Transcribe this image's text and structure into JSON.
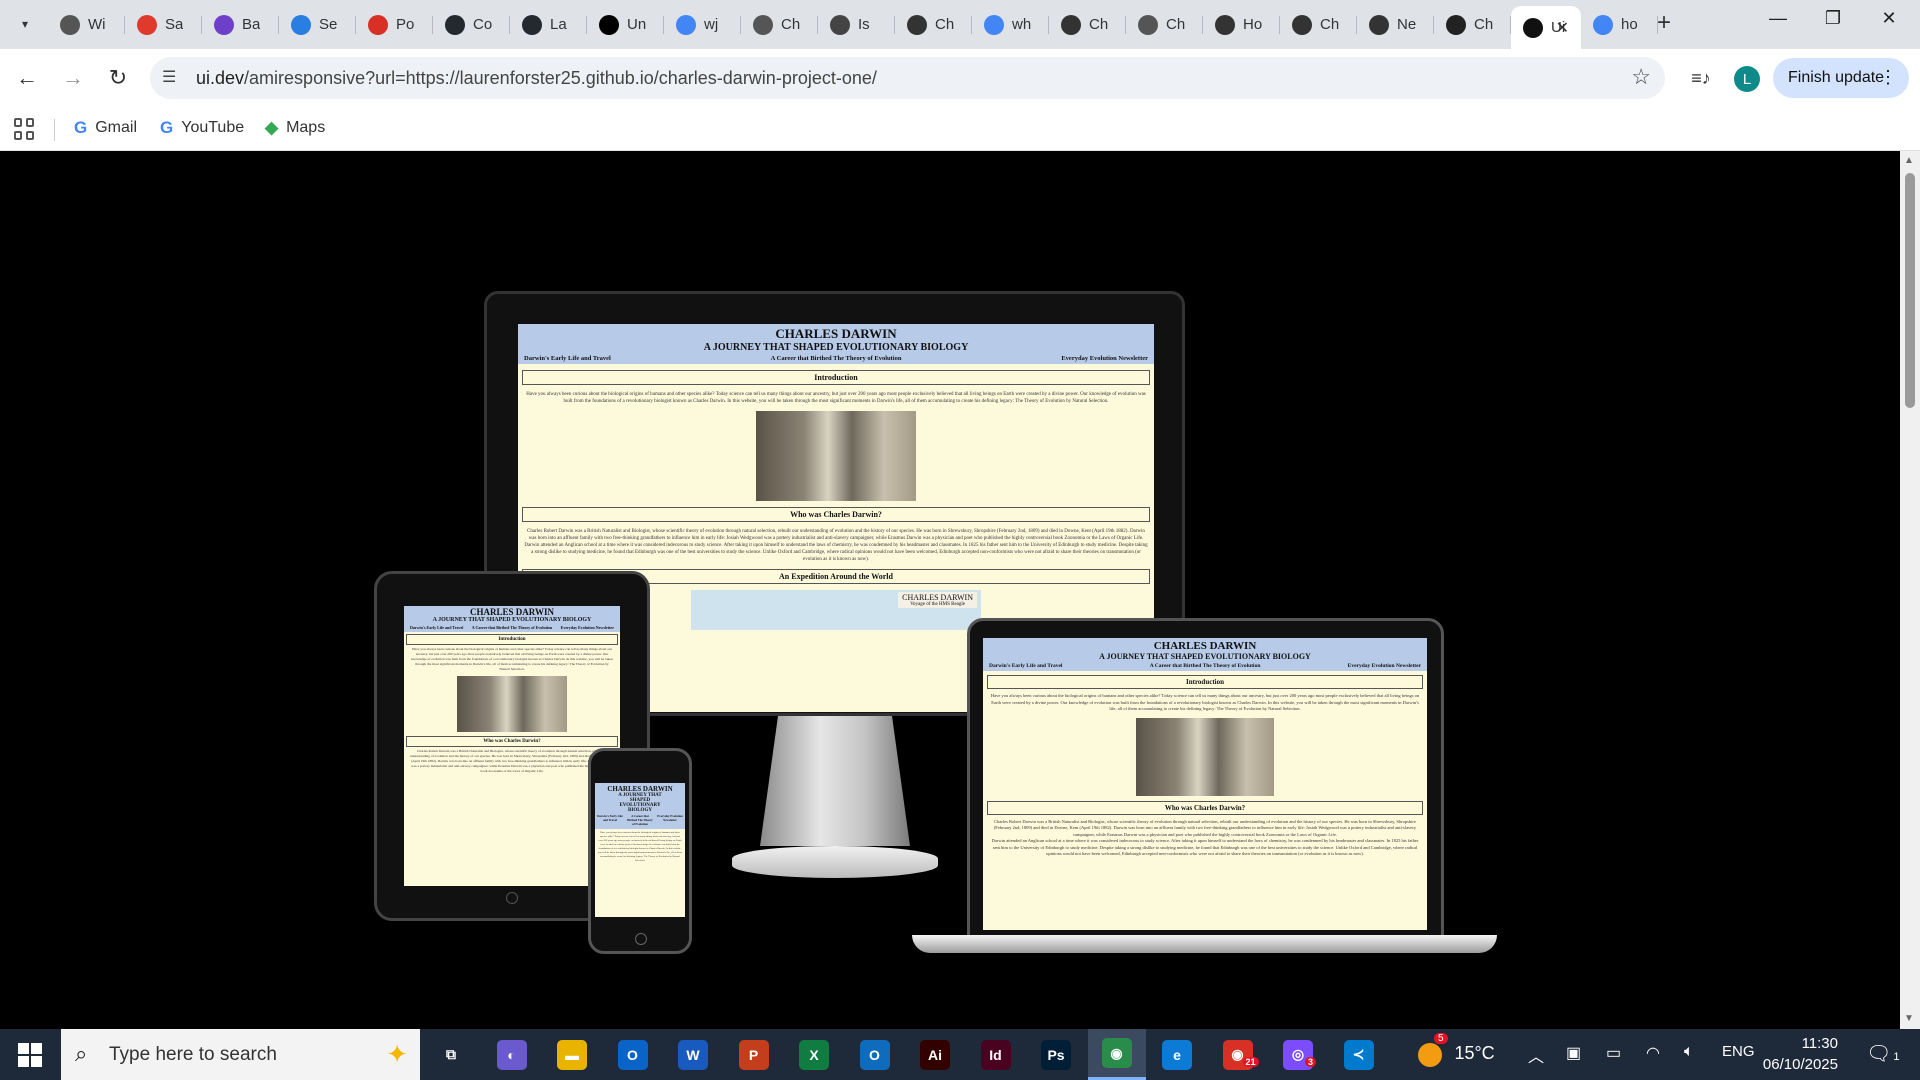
{
  "browser": {
    "tabs": [
      {
        "label": "Wi",
        "icon": "wikipedia-icon",
        "color": "#555555"
      },
      {
        "label": "Sa",
        "icon": "opera-icon",
        "color": "#e03a2c"
      },
      {
        "label": "Ba",
        "icon": "github-icon",
        "color": "#6e40c9"
      },
      {
        "label": "Se",
        "icon": "puzzle-icon",
        "color": "#2a7de1"
      },
      {
        "label": "Po",
        "icon": "gmail-icon",
        "color": "#d93025"
      },
      {
        "label": "Co",
        "icon": "github-icon",
        "color": "#24292f"
      },
      {
        "label": "La",
        "icon": "github-icon",
        "color": "#24292f"
      },
      {
        "label": "Un",
        "icon": "medium-icon",
        "color": "#000000"
      },
      {
        "label": "wj",
        "icon": "google-icon",
        "color": "#4285f4"
      },
      {
        "label": "Ch",
        "icon": "globe-icon",
        "color": "#555555"
      },
      {
        "label": "Is",
        "icon": "stack-icon",
        "color": "#444444"
      },
      {
        "label": "Ch",
        "icon": "openai-icon",
        "color": "#333333"
      },
      {
        "label": "wh",
        "icon": "google-icon",
        "color": "#4285f4"
      },
      {
        "label": "Ch",
        "icon": "openai-icon",
        "color": "#333333"
      },
      {
        "label": "Ch",
        "icon": "globe-icon",
        "color": "#555555"
      },
      {
        "label": "Ho",
        "icon": "feather-icon",
        "color": "#333333"
      },
      {
        "label": "Ch",
        "icon": "openai-icon",
        "color": "#333333"
      },
      {
        "label": "Ne",
        "icon": "openai-icon",
        "color": "#333333"
      },
      {
        "label": "Ch",
        "icon": "pen-icon",
        "color": "#222222"
      }
    ],
    "active_tab": {
      "label": "Ui",
      "icon": "ui-dev-icon"
    },
    "last_tab": {
      "label": "ho",
      "icon": "google-icon"
    },
    "url_host": "ui.dev",
    "url_rest": "/amiresponsive?url=https://laurenforster25.github.io/charles-darwin-project-one/",
    "profile_initial": "L",
    "finish_update": "Finish update",
    "bookmarks": [
      {
        "label": "Gmail"
      },
      {
        "label": "YouTube"
      },
      {
        "label": "Maps"
      }
    ]
  },
  "site": {
    "title": "CHARLES DARWIN",
    "subtitle": "A JOURNEY THAT SHAPED EVOLUTIONARY BIOLOGY",
    "subtitle_phone_1": "A JOURNEY THAT",
    "subtitle_phone_2": "SHAPED",
    "subtitle_phone_3": "EVOLUTIONARY",
    "subtitle_phone_4": "BIOLOGY",
    "nav": [
      "Darwin's Early Life and Travel",
      "A Career that Birthed The Theory of Evolution",
      "Everyday Evolution Newsletter"
    ],
    "intro_heading": "Introduction",
    "intro_text": "Have you always been curious about the biological origins of humans and other species alike? Today science can tell us many things about our ancestry, but just over 200 years ago most people exclusively believed that all living beings on Earth were created by a divine power. Our knowledge of evolution was built from the foundations of a revolutionary biologist known as Charles Darwin. In this website, you will be taken through the most significant moments in Darwin's life, all of them accumulating to create his defining legacy: The Theory of Evolution by Natural Selection.",
    "who_heading": "Who was Charles Darwin?",
    "who_text": "Charles Robert Darwin was a British Naturalist and Biologist, whose scientific theory of evolution through natural selection, rebuilt our understanding of evolution and the history of our species. He was born in Shrewsbury, Shropshire (February 2nd, 1809) and died in Downe, Kent (April 19th 1882). Darwin was born into an affluent family with two free-thinking grandfathers to influence him in early life: Josiah Wedgwood was a pottery industrialist and anti-slavery campaigner, while Erasmus Darwin was a physician and poet who published the highly controversial book Zoonomia or the Laws of Organic Life.",
    "who_text_2": "Darwin attended an Anglican school at a time where it was considered indecorous to study science. After taking it upon himself to understand the laws of chemistry, he was condemned by his headmaster and classmates. In 1825 his father sent him to the University of Edinburgh to study medicine. Despite taking a strong dislike to studying medicine, he found that Edinburgh was one of the best universities to study the science. Unlike Oxford and Cambridge, where radical opinions would not have been welcomed, Edinburgh accepted non-conformists who were not afraid to share their theories on transmutation (or evolution as it is known as now).",
    "expedition_heading": "An Expedition Around the World",
    "map_caption": "CHARLES DARWIN",
    "map_sub": "Voyage of the HMS Beagle"
  },
  "taskbar": {
    "search_placeholder": "Type here to search",
    "apps": [
      {
        "name": "task-view",
        "glyph": "⧉",
        "color": "#1e2a3a"
      },
      {
        "name": "copilot",
        "glyph": "◐",
        "color": "#6a5acd"
      },
      {
        "name": "file-explorer",
        "glyph": "▬",
        "color": "#e8b400"
      },
      {
        "name": "outlook",
        "glyph": "O",
        "color": "#0a64c8"
      },
      {
        "name": "word",
        "glyph": "W",
        "color": "#185abd"
      },
      {
        "name": "powerpoint",
        "glyph": "P",
        "color": "#c43e1c"
      },
      {
        "name": "excel",
        "glyph": "X",
        "color": "#107c41"
      },
      {
        "name": "outlook-classic",
        "glyph": "O",
        "color": "#0f6cbd"
      },
      {
        "name": "illustrator",
        "glyph": "Ai",
        "color": "#330000"
      },
      {
        "name": "indesign",
        "glyph": "Id",
        "color": "#49021f"
      },
      {
        "name": "photoshop",
        "glyph": "Ps",
        "color": "#001e36"
      },
      {
        "name": "chrome",
        "glyph": "◉",
        "color": "#2a8c4a"
      },
      {
        "name": "edge",
        "glyph": "e",
        "color": "#0c7bd6"
      },
      {
        "name": "chrome-profile",
        "glyph": "◉",
        "color": "#d93025"
      },
      {
        "name": "messenger",
        "glyph": "◎",
        "color": "#7b4dff"
      },
      {
        "name": "vscode",
        "glyph": "≺",
        "color": "#007acc"
      }
    ],
    "badge_21": "21",
    "badge_3": "3",
    "weather_badge": "5",
    "temperature": "15°C",
    "language": "ENG",
    "time": "11:30",
    "date": "06/10/2025",
    "notification_count": "1"
  }
}
